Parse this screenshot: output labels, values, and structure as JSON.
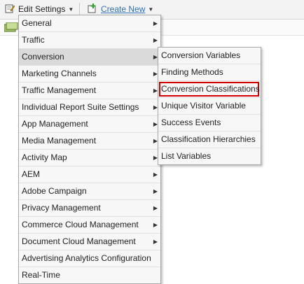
{
  "toolbar": {
    "edit_settings_label": "Edit Settings",
    "create_new_label": "Create New"
  },
  "menu": {
    "items": [
      {
        "label": "General",
        "has_submenu": true
      },
      {
        "label": "Traffic",
        "has_submenu": true
      },
      {
        "label": "Conversion",
        "has_submenu": true
      },
      {
        "label": "Marketing Channels",
        "has_submenu": true
      },
      {
        "label": "Traffic Management",
        "has_submenu": true
      },
      {
        "label": "Individual Report Suite Settings",
        "has_submenu": true
      },
      {
        "label": "App Management",
        "has_submenu": true
      },
      {
        "label": "Media Management",
        "has_submenu": true
      },
      {
        "label": "Activity Map",
        "has_submenu": true
      },
      {
        "label": "AEM",
        "has_submenu": true
      },
      {
        "label": "Adobe Campaign",
        "has_submenu": true
      },
      {
        "label": "Privacy Management",
        "has_submenu": true
      },
      {
        "label": "Commerce Cloud Management",
        "has_submenu": true
      },
      {
        "label": "Document Cloud Management",
        "has_submenu": true
      },
      {
        "label": "Advertising Analytics Configuration",
        "has_submenu": false
      },
      {
        "label": "Real-Time",
        "has_submenu": false
      }
    ]
  },
  "submenu": {
    "items": [
      {
        "label": "Conversion Variables"
      },
      {
        "label": "Finding Methods"
      },
      {
        "label": "Conversion Classifications"
      },
      {
        "label": "Unique Visitor Variable"
      },
      {
        "label": "Success Events"
      },
      {
        "label": "Classification Hierarchies"
      },
      {
        "label": "List Variables"
      }
    ]
  },
  "colors": {
    "highlight_border": "#d40000",
    "link": "#2d6fb5",
    "active_item": "#dadada"
  }
}
